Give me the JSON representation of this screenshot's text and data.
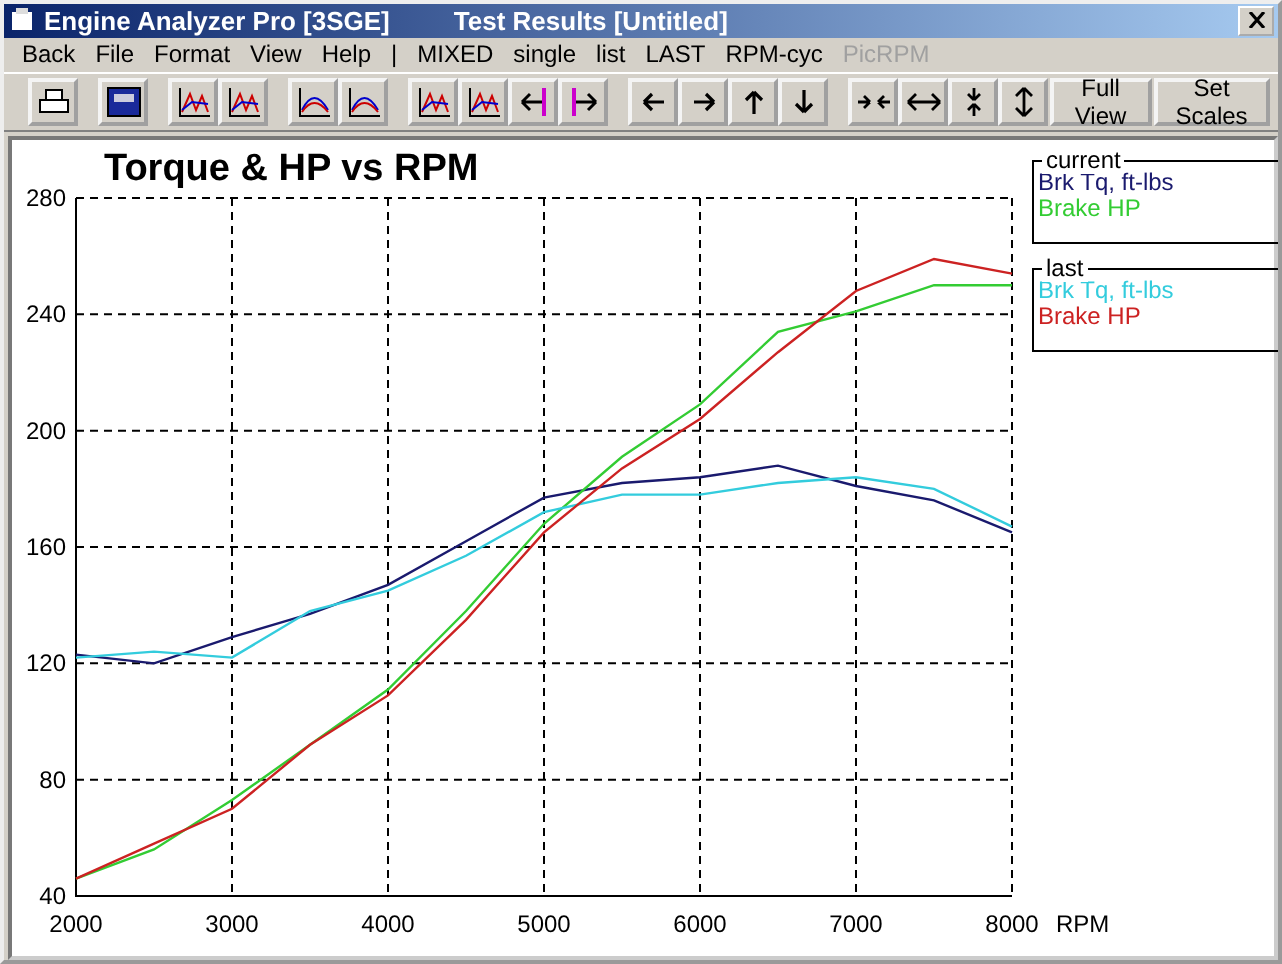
{
  "window": {
    "title": "Engine Analyzer Pro [3SGE]",
    "subtitle": "Test Results [Untitled]"
  },
  "menu": [
    {
      "label": "Back",
      "disabled": false
    },
    {
      "label": "File",
      "disabled": false
    },
    {
      "label": "Format",
      "disabled": false
    },
    {
      "label": "View",
      "disabled": false
    },
    {
      "label": "Help",
      "disabled": false
    },
    {
      "label": "|",
      "disabled": false
    },
    {
      "label": "MIXED",
      "disabled": false
    },
    {
      "label": "single",
      "disabled": false
    },
    {
      "label": "list",
      "disabled": false
    },
    {
      "label": "LAST",
      "disabled": false
    },
    {
      "label": "RPM-cyc",
      "disabled": false
    },
    {
      "label": "PicRPM",
      "disabled": true
    }
  ],
  "toolbar": {
    "buttons": [
      "Full View",
      "Set Scales"
    ]
  },
  "chart": {
    "chart_data": {
      "type": "line",
      "title": "Torque & HP vs RPM",
      "xlabel": "RPM",
      "grid": true,
      "x": [
        2000,
        2500,
        3000,
        3500,
        4000,
        4500,
        5000,
        5500,
        6000,
        6500,
        7000,
        7500,
        8000
      ],
      "xlim": [
        2000,
        8000
      ],
      "ylim": [
        40,
        280
      ],
      "xticks": [
        2000,
        3000,
        4000,
        5000,
        6000,
        7000,
        8000
      ],
      "yticks": [
        40,
        80,
        120,
        160,
        200,
        240,
        280
      ],
      "series": [
        {
          "name": "Brk Tq, ft-lbs",
          "color": "#1a1a6e",
          "values": [
            123,
            120,
            129,
            137,
            147,
            162,
            177,
            182,
            184,
            188,
            181,
            176,
            165
          ]
        },
        {
          "name": "Brake HP",
          "color": "#33cc33",
          "values": [
            46,
            56,
            73,
            92,
            111,
            138,
            168,
            191,
            209,
            234,
            241,
            250,
            250
          ]
        },
        {
          "name": "Brk Tq, ft-lbs",
          "color": "#33ccdd",
          "values": [
            122,
            124,
            122,
            138,
            145,
            157,
            172,
            178,
            178,
            182,
            184,
            180,
            167
          ]
        },
        {
          "name": "Brake HP",
          "color": "#cc2222",
          "values": [
            46,
            58,
            70,
            92,
            109,
            135,
            165,
            187,
            204,
            227,
            248,
            259,
            254
          ]
        }
      ]
    }
  },
  "legend": [
    {
      "label": "current"
    },
    {
      "label": "last"
    }
  ]
}
